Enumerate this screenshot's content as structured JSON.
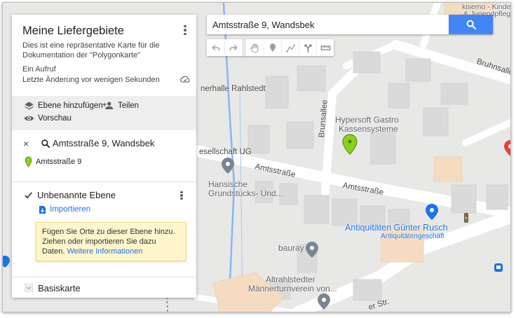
{
  "search": {
    "value": "Amtsstraße 9, Wandsbek",
    "button_icon": "search-icon"
  },
  "toolbar": {
    "tools": [
      "undo-icon",
      "redo-icon",
      "hand-icon",
      "marker-icon",
      "line-icon",
      "route-icon",
      "ruler-icon"
    ]
  },
  "panel": {
    "title": "Meine Liefergebiete",
    "description": "Dies ist eine repräsentative Karte für die Dokumentation der \"Polygonkarte\"",
    "views": "Ein Aufruf",
    "last_change": "Letzte Änderung vor wenigen Sekunden",
    "actions": {
      "add_layer": "Ebene hinzufügen",
      "share": "Teilen",
      "preview": "Vorschau"
    },
    "result": {
      "close": "×",
      "query": "Amtsstraße 9, Wandsbek",
      "item": "Amtsstraße 9"
    },
    "layer": {
      "name": "Unbenannte Ebene",
      "import": "Importieren",
      "tip_text": "Fügen Sie Orte zu dieser Ebene hinzu. Ziehen oder importieren Sie dazu Daten.",
      "tip_link": "Weitere Informationen"
    },
    "basemap": "Basiskarte"
  },
  "map": {
    "labels": {
      "rahlstedt": "nerhalle Rahlstedt",
      "gesellschaft": "esellschaft UG",
      "hypersoft1": "Hypersoft Gastro",
      "hypersoft2": "Kassensysteme",
      "brunsallee": "Brunsallee",
      "bruhnsallee": "Bruhnsalle",
      "amts1": "Amtsstraße",
      "amts2": "Amtsstraße",
      "hansische1": "Hansische",
      "hansische2": "Grundstücks- Und...",
      "antik": "Antiquitäten Günter Rusch",
      "antik_sub": "Antiquitätengeschäft",
      "bauray": "bauray",
      "altrahl1": "Altrahlstedter",
      "altrahl2": "Männerturnverein von...",
      "str": "er Str.",
      "topright1": "kisemo - Kinder-",
      "topright2": "& Jugendpflege"
    },
    "colors": {
      "selected_pin": "#8bd11b",
      "poi_blue": "#1a73e8",
      "poi_grey": "#7a8590",
      "search_button": "#4285f4"
    }
  }
}
